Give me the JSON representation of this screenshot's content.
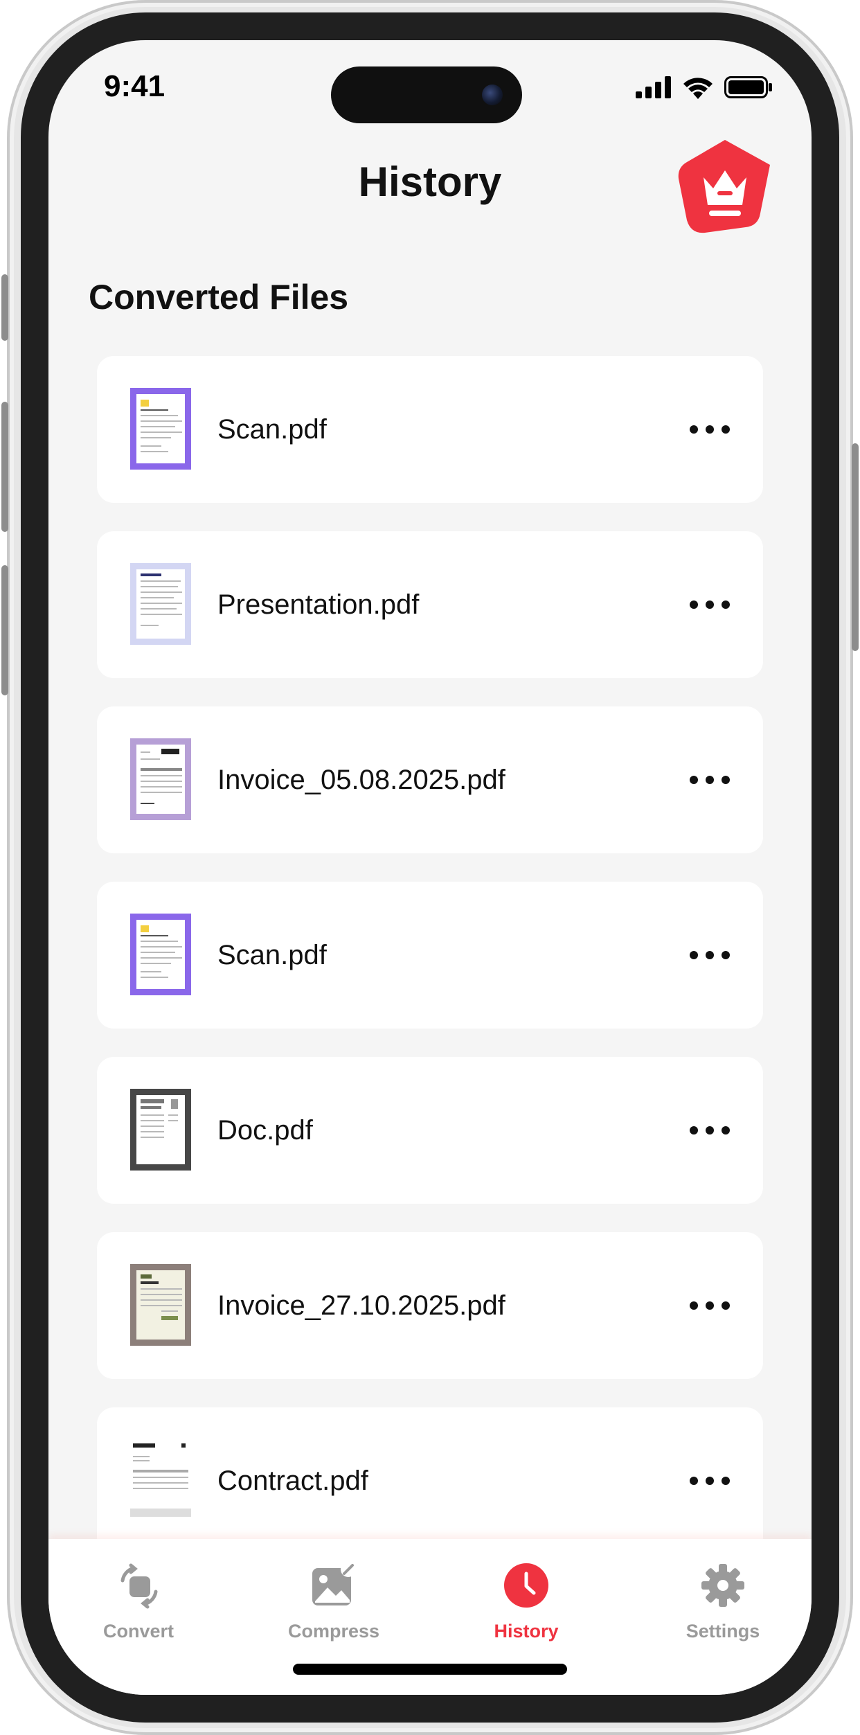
{
  "status_bar": {
    "time": "9:41"
  },
  "header": {
    "title": "History",
    "premium_icon": "crown-icon"
  },
  "section": {
    "title": "Converted Files"
  },
  "files": [
    {
      "name": "Scan.pdf",
      "thumb_color": "#8a67ea"
    },
    {
      "name": "Presentation.pdf",
      "thumb_color": "#d3d6f3"
    },
    {
      "name": "Invoice_05.08.2025.pdf",
      "thumb_color": "#b69fd6"
    },
    {
      "name": "Scan.pdf",
      "thumb_color": "#8a67ea"
    },
    {
      "name": "Doc.pdf",
      "thumb_color": "#474747"
    },
    {
      "name": "Invoice_27.10.2025.pdf",
      "thumb_color": "#8c7f7a"
    },
    {
      "name": "Contract.pdf",
      "thumb_color": "#ffffff"
    }
  ],
  "tabs": [
    {
      "label": "Convert",
      "icon": "convert-icon",
      "active": false
    },
    {
      "label": "Compress",
      "icon": "image-compress-icon",
      "active": false
    },
    {
      "label": "History",
      "icon": "clock-icon",
      "active": true
    },
    {
      "label": "Settings",
      "icon": "gear-icon",
      "active": false
    }
  ],
  "colors": {
    "accent": "#ef3340",
    "inactive": "#9a9a9a",
    "background": "#f5f5f5"
  }
}
